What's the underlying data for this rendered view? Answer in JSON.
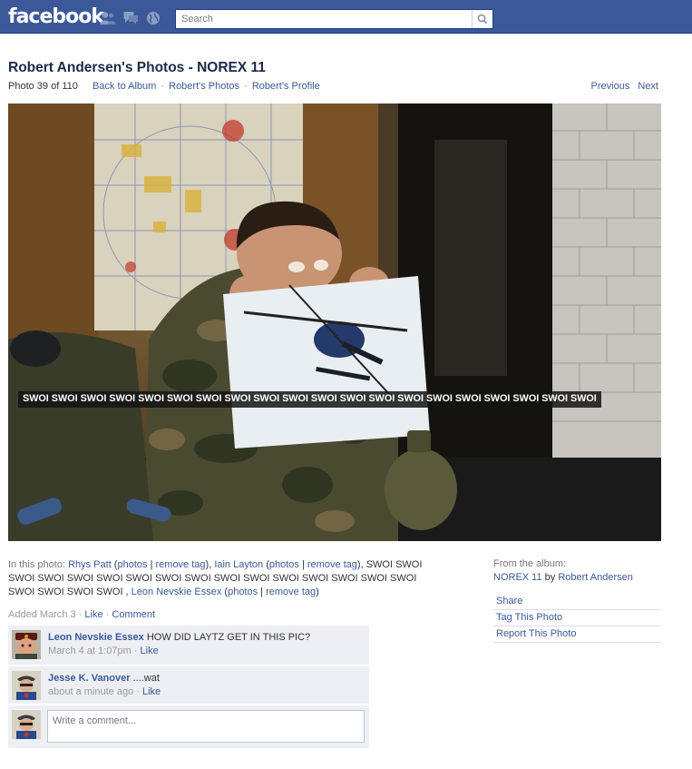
{
  "topbar": {
    "logo": "facebook",
    "search_placeholder": "Search",
    "icons": [
      "friend-requests-icon",
      "messages-icon",
      "notifications-globe-icon",
      "search-magnifier-icon"
    ]
  },
  "header": {
    "title": "Robert Andersen's Photos - NOREX 11",
    "position": "Photo 39 of 110",
    "links": [
      "Back to Album",
      "Robert's Photos",
      "Robert's Profile"
    ],
    "separator": "·",
    "previous": "Previous",
    "next": "Next"
  },
  "photo": {
    "tag_overlay": "SWOI SWOI SWOI SWOI SWOI SWOI SWOI SWOI SWOI SWOI SWOI SWOI SWOI SWOI SWOI SWOI SWOI SWOI SWOI SWOI"
  },
  "tags": {
    "prefix": "In this photo:",
    "p1_name": "Rhys Patt",
    "p2_name": "Iain Layton",
    "p3_name": "Leon Nevskie Essex",
    "photos_link": "photos",
    "remove_link": "remove tag",
    "swoi_text": "SWOI SWOI SWOI SWOI SWOI SWOI SWOI SWOI SWOI SWOI SWOI SWOI SWOI SWOI SWOI SWOI SWOI SWOI SWOI SWOI"
  },
  "added": {
    "text": "Added March 3",
    "like": "Like",
    "comment": "Comment",
    "separator": "·"
  },
  "album": {
    "label": "From the album:",
    "name": "NOREX 11",
    "by": "by",
    "owner": "Robert Andersen",
    "actions": [
      "Share",
      "Tag This Photo",
      "Report This Photo"
    ]
  },
  "comments": [
    {
      "author": "Leon Nevskie Essex",
      "text": "HOW DID LAYTZ GET IN THIS PIC?",
      "time": "March 4 at 1:07pm",
      "like": "Like"
    },
    {
      "author": "Jesse K. Vanover",
      "text": "....wat",
      "time": "about a minute ago",
      "like": "Like"
    }
  ],
  "comment_box": {
    "placeholder": "Write a comment..."
  },
  "colors": {
    "brand": "#3b5998",
    "link": "#3b5998",
    "comment_bg": "#edeff4",
    "title": "#1c2a47"
  }
}
